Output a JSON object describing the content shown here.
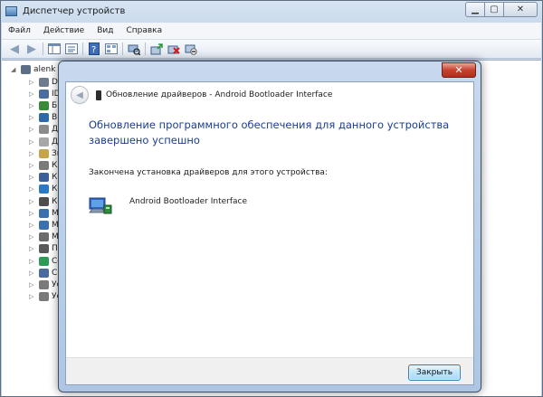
{
  "window": {
    "title": "Диспетчер устройств",
    "controls": {
      "minimize": "▁",
      "maximize": "▢",
      "close": "✕"
    }
  },
  "menu": [
    {
      "label": "Файл"
    },
    {
      "label": "Действие"
    },
    {
      "label": "Вид"
    },
    {
      "label": "Справка"
    }
  ],
  "tree": {
    "root": "alenk",
    "items": [
      {
        "label": "D",
        "color": "#6d7b8f"
      },
      {
        "label": "ID",
        "color": "#4a6da0"
      },
      {
        "label": "Б",
        "color": "#3b8a3b"
      },
      {
        "label": "Ви",
        "color": "#2f6aa8"
      },
      {
        "label": "Д",
        "color": "#8b8b8b"
      },
      {
        "label": "Д",
        "color": "#a7a7a7"
      },
      {
        "label": "Зв",
        "color": "#c9a34a"
      },
      {
        "label": "Кл",
        "color": "#7a7a7a"
      },
      {
        "label": "Ко",
        "color": "#3a5f9a"
      },
      {
        "label": "Ко",
        "color": "#2b78c4"
      },
      {
        "label": "Ко",
        "color": "#4e4e4e"
      },
      {
        "label": "М",
        "color": "#3a6fb0"
      },
      {
        "label": "М",
        "color": "#3a6fb0"
      },
      {
        "label": "М",
        "color": "#6c6c6c"
      },
      {
        "label": "Пр",
        "color": "#5a5a5a"
      },
      {
        "label": "Се",
        "color": "#2e9a55"
      },
      {
        "label": "Си",
        "color": "#4a6aa0"
      },
      {
        "label": "Ус",
        "color": "#7a7a7a"
      },
      {
        "label": "Ус",
        "color": "#7a7a7a"
      }
    ]
  },
  "dialog": {
    "title": "Обновление драйверов - Android Bootloader Interface",
    "heading": "Обновление программного обеспечения для данного устройства завершено успешно",
    "subtext": "Закончена установка драйверов для этого устройства:",
    "device_name": "Android Bootloader Interface",
    "close_button": "Закрыть",
    "close_x": "✕"
  }
}
